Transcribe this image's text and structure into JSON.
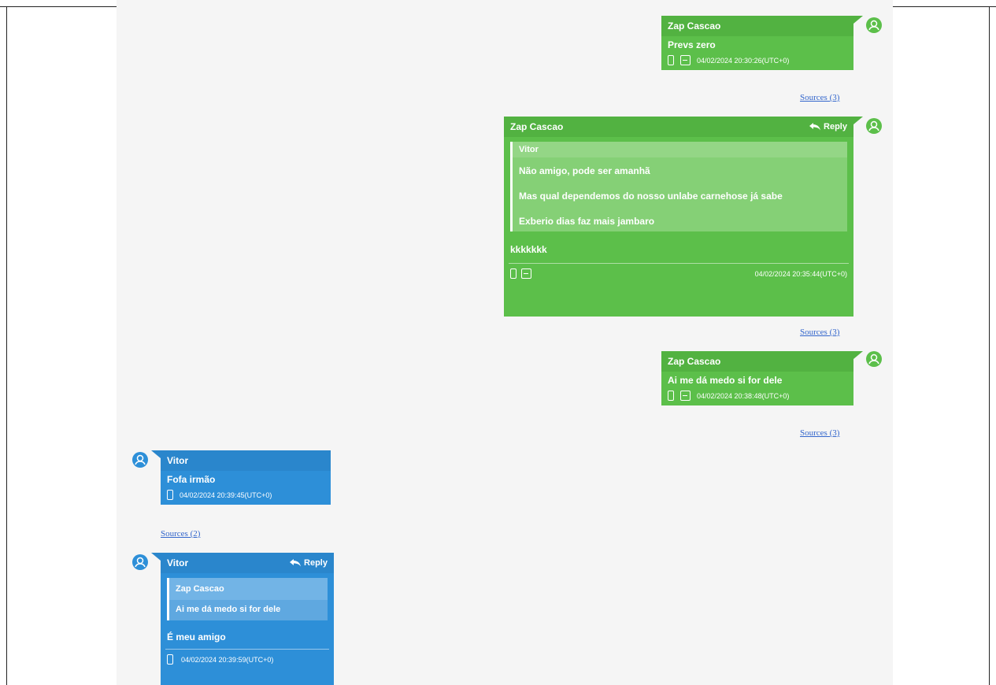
{
  "messages": [
    {
      "author": "Zap Cascao",
      "text": "Prevs zero",
      "timestamp": "04/02/2024 20:30:26(UTC+0)",
      "sources": "Sources (3)"
    },
    {
      "author": "Zap Cascao",
      "reply_label": "Reply",
      "quote_author": "Vitor",
      "quote_lines": [
        "Não amigo, pode ser amanhã",
        "Mas qual dependemos do nosso unlabe carnehose já sabe",
        "Exberio dias faz mais jambaro"
      ],
      "text": "kkkkkkk",
      "timestamp": "04/02/2024 20:35:44(UTC+0)",
      "sources": "Sources (3)"
    },
    {
      "author": "Zap Cascao",
      "text": "Ai me dá medo si for dele",
      "timestamp": "04/02/2024 20:38:48(UTC+0)",
      "sources": "Sources (3)"
    },
    {
      "author": "Vitor",
      "text": "Fofa irmão",
      "timestamp": "04/02/2024 20:39:45(UTC+0)",
      "sources": "Sources (2)"
    },
    {
      "author": "Vitor",
      "reply_label": "Reply",
      "quote_author": "Zap Cascao",
      "quote_lines": [
        "Ai me dá medo si for dele"
      ],
      "text": "É meu amigo",
      "timestamp": "04/02/2024 20:39:59(UTC+0)"
    }
  ],
  "colors": {
    "outgoing": "#5cbf4a",
    "incoming": "#2d8fd8",
    "background": "#f5f5f5",
    "link": "#3366cc"
  },
  "icons": [
    "user-icon",
    "phone-icon",
    "attachment-icon",
    "reply-icon"
  ]
}
